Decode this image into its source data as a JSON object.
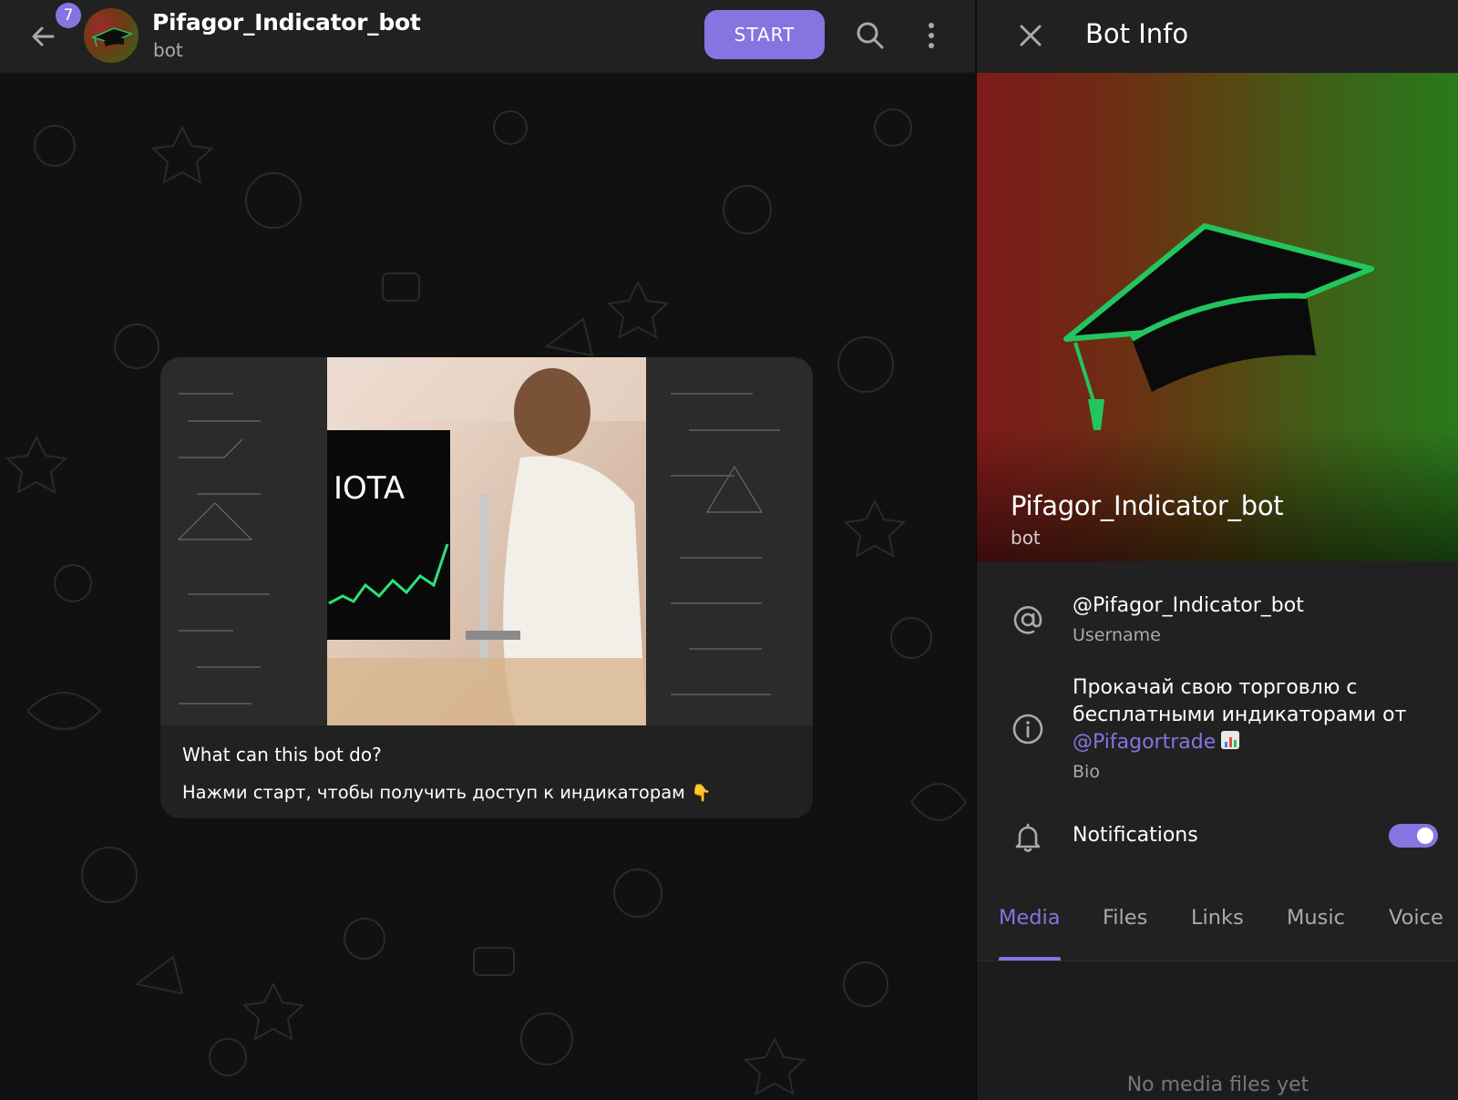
{
  "header": {
    "unread_count": "7",
    "title": "Pifagor_Indicator_bot",
    "subtitle": "bot",
    "start_label": "START"
  },
  "message": {
    "title": "What can this bot do?",
    "text": "Нажми старт, чтобы получить доступ к индикаторам",
    "emoji": "👇",
    "media_overlay_text": "IOTA"
  },
  "panel": {
    "title": "Bot Info",
    "name": "Pifagor_Indicator_bot",
    "subtitle": "bot",
    "username": "@Pifagor_Indicator_bot",
    "username_label": "Username",
    "bio_line1": "Прокачай свою торговлю с",
    "bio_line2": "бесплатными индикаторами от",
    "bio_link": "@Pifagortrade",
    "bio_label": "Bio",
    "notifications_label": "Notifications",
    "notifications_on": true,
    "tabs": [
      {
        "label": "Media",
        "active": true
      },
      {
        "label": "Files",
        "active": false
      },
      {
        "label": "Links",
        "active": false
      },
      {
        "label": "Music",
        "active": false
      },
      {
        "label": "Voice",
        "active": false
      }
    ],
    "empty_text": "No media files yet"
  },
  "colors": {
    "accent": "#8774e1",
    "panel_bg": "#212121",
    "chat_bg": "#111111",
    "cap_green": "#22c55e"
  },
  "icons": [
    "back-arrow-icon",
    "search-icon",
    "more-vertical-icon",
    "close-icon",
    "at-icon",
    "info-icon",
    "bell-icon",
    "graduation-cap-icon",
    "chart-emoji-icon"
  ]
}
